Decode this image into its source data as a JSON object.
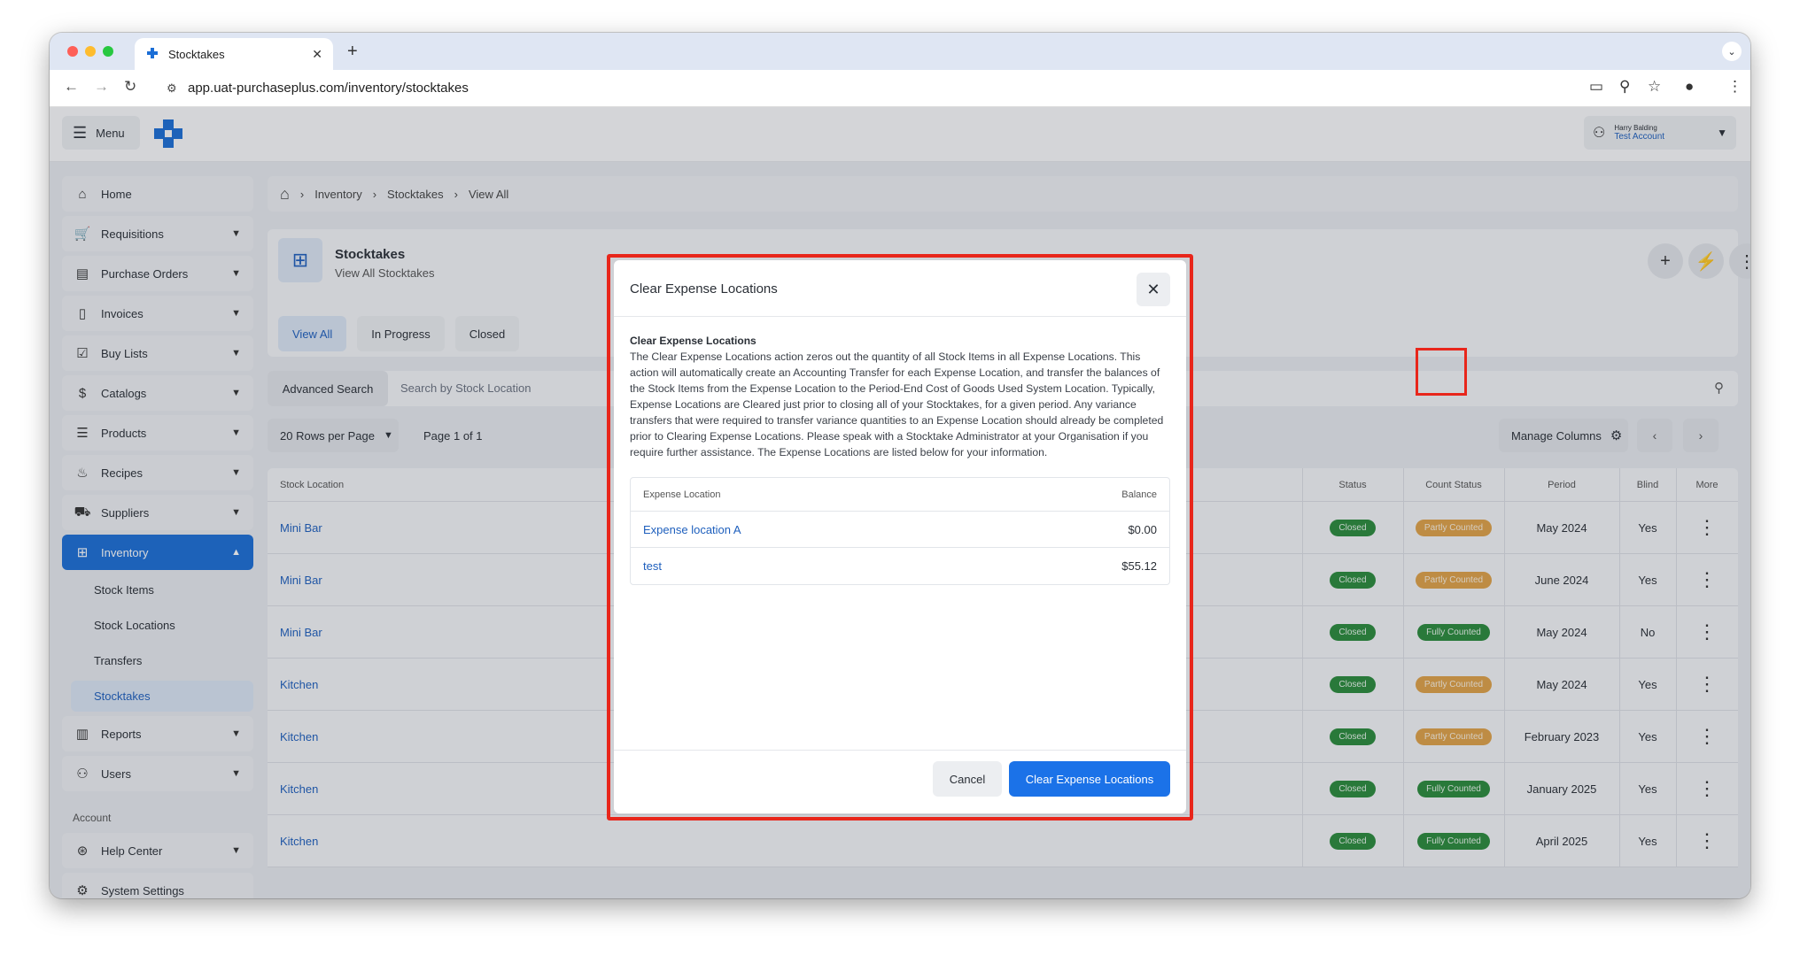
{
  "browser": {
    "tab_title": "Stocktakes",
    "url": "app.uat-purchaseplus.com/inventory/stocktakes"
  },
  "topbar": {
    "menu_label": "Menu",
    "user_name": "Harry Balding",
    "user_account": "Test Account"
  },
  "sidebar": {
    "items": [
      {
        "label": "Home",
        "icon": "home-icon"
      },
      {
        "label": "Requisitions",
        "icon": "cart-icon"
      },
      {
        "label": "Purchase Orders",
        "icon": "clipboard-icon"
      },
      {
        "label": "Invoices",
        "icon": "invoice-icon"
      },
      {
        "label": "Buy Lists",
        "icon": "checklist-icon"
      },
      {
        "label": "Catalogs",
        "icon": "dollar-doc-icon"
      },
      {
        "label": "Products",
        "icon": "stack-icon"
      },
      {
        "label": "Recipes",
        "icon": "flame-icon"
      },
      {
        "label": "Suppliers",
        "icon": "truck-icon"
      },
      {
        "label": "Inventory",
        "icon": "boxes-icon"
      }
    ],
    "inventory_sub": [
      "Stock Items",
      "Stock Locations",
      "Transfers",
      "Stocktakes"
    ],
    "items_after": [
      {
        "label": "Reports",
        "icon": "bar-chart-icon"
      },
      {
        "label": "Users",
        "icon": "user-icon"
      }
    ],
    "account_section": "Account",
    "account_items": [
      {
        "label": "Help Center",
        "icon": "lifebuoy-icon"
      },
      {
        "label": "System Settings",
        "icon": "gear-icon"
      }
    ]
  },
  "breadcrumb": [
    "Inventory",
    "Stocktakes",
    "View All"
  ],
  "header": {
    "title": "Stocktakes",
    "subtitle": "View All Stocktakes"
  },
  "filter_tabs": [
    "View All",
    "In Progress",
    "Closed"
  ],
  "search": {
    "advanced_label": "Advanced Search",
    "placeholder": "Search by Stock Location"
  },
  "pagination": {
    "rows_per_page": "20 Rows per Page",
    "page_info": "Page 1 of 1",
    "manage_columns": "Manage Columns"
  },
  "table": {
    "columns": [
      "Stock Location",
      "Status",
      "Count Status",
      "Period",
      "Blind",
      "More"
    ],
    "rows": [
      {
        "location": "Mini Bar",
        "status": "Closed",
        "count_status": "Partly Counted",
        "period": "May 2024",
        "blind": "Yes"
      },
      {
        "location": "Mini Bar",
        "status": "Closed",
        "count_status": "Partly Counted",
        "period": "June 2024",
        "blind": "Yes"
      },
      {
        "location": "Mini Bar",
        "status": "Closed",
        "count_status": "Fully Counted",
        "period": "May 2024",
        "blind": "No"
      },
      {
        "location": "Kitchen",
        "status": "Closed",
        "count_status": "Partly Counted",
        "period": "May 2024",
        "blind": "Yes"
      },
      {
        "location": "Kitchen",
        "status": "Closed",
        "count_status": "Partly Counted",
        "period": "February 2023",
        "blind": "Yes"
      },
      {
        "location": "Kitchen",
        "status": "Closed",
        "count_status": "Fully Counted",
        "period": "January 2025",
        "blind": "Yes"
      },
      {
        "location": "Kitchen",
        "status": "Closed",
        "count_status": "Fully Counted",
        "period": "April 2025",
        "blind": "Yes"
      }
    ]
  },
  "modal": {
    "title": "Clear Expense Locations",
    "subtitle": "Clear Expense Locations",
    "description": "The Clear Expense Locations action zeros out the quantity of all Stock Items in all Expense Locations. This action will automatically create an Accounting Transfer for each Expense Location, and transfer the balances of the Stock Items from the Expense Location to the Period-End Cost of Goods Used System Location. Typically, Expense Locations are Cleared just prior to closing all of your Stocktakes, for a given period. Any variance transfers that were required to transfer variance quantities to an Expense Location should already be completed prior to Clearing Expense Locations. Please speak with a Stocktake Administrator at your Organisation if you require further assistance. The Expense Locations are listed below for your information.",
    "table_headers": {
      "location": "Expense Location",
      "balance": "Balance"
    },
    "rows": [
      {
        "location": "Expense location A",
        "balance": "$0.00"
      },
      {
        "location": "test",
        "balance": "$55.12"
      }
    ],
    "cancel_label": "Cancel",
    "confirm_label": "Clear Expense Locations"
  },
  "colors": {
    "accent": "#1b6ed6",
    "highlight": "#e8261b",
    "closed_badge": "#2a8a3b",
    "partly_badge": "#e0a247"
  }
}
